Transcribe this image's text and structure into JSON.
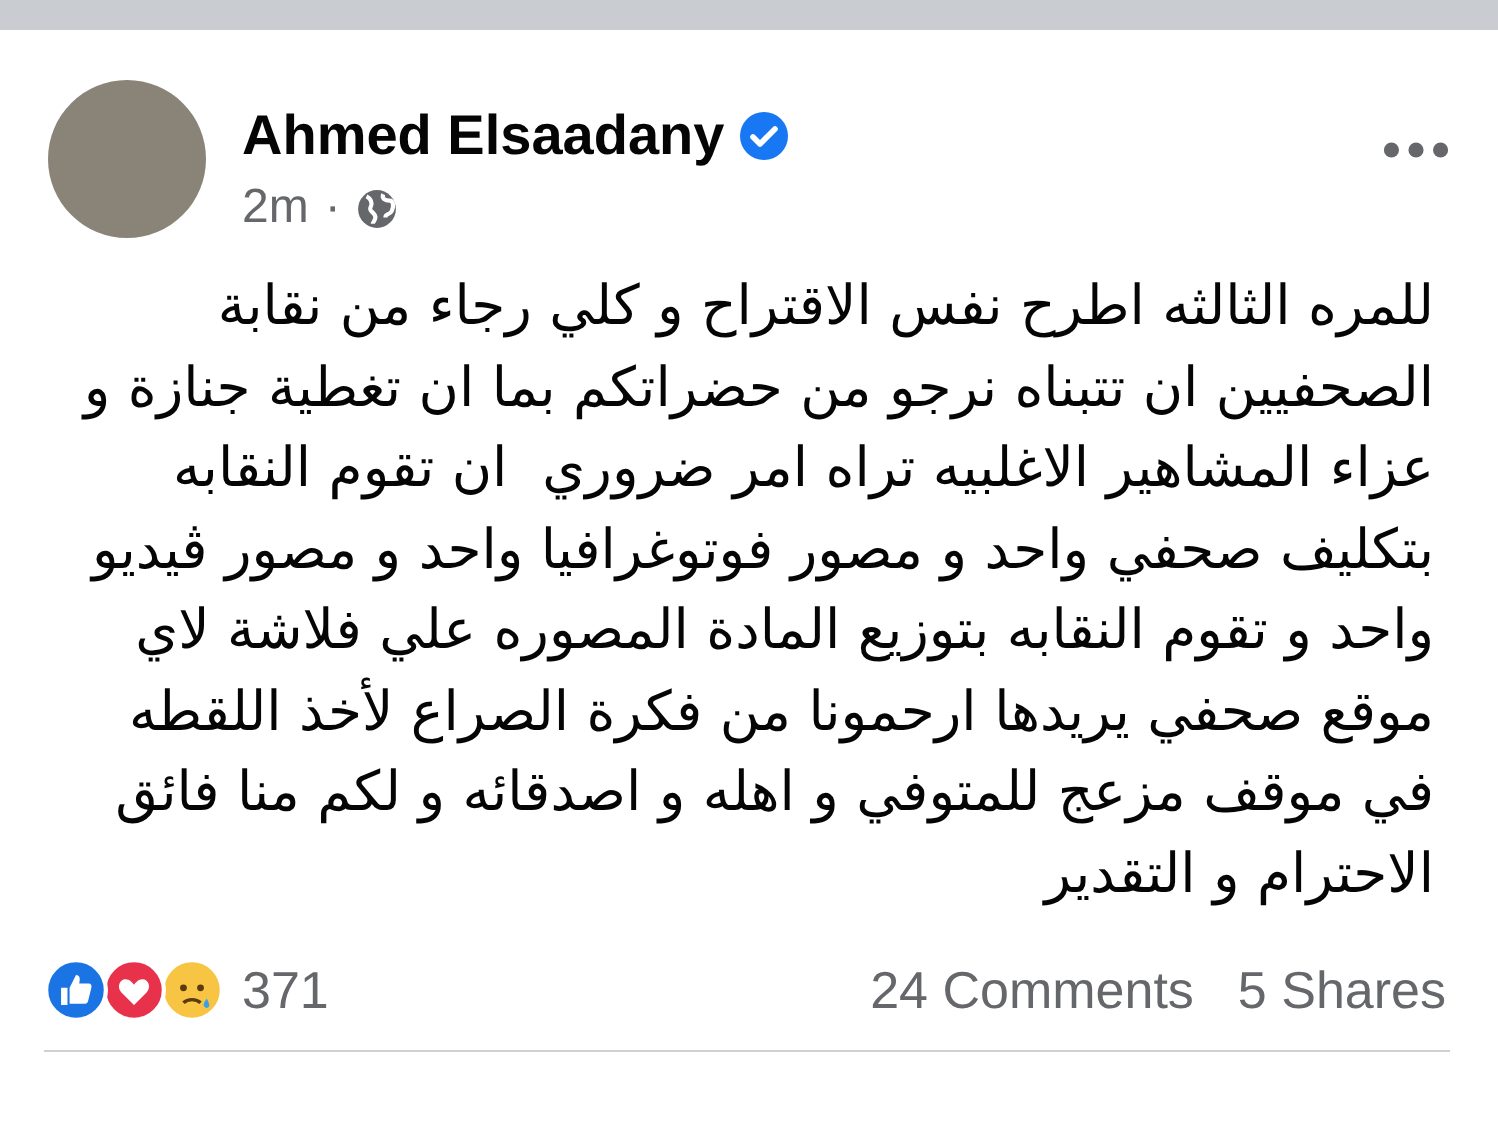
{
  "post": {
    "author": "Ahmed Elsaadany",
    "verified": true,
    "time": "2m",
    "separator": "·",
    "text": "للمره الثالثه اطرح نفس الاقتراح و كلي رجاء من نقابة\nالصحفيين ان تتبناه نرجو من حضراتكم بما ان تغطية جنازة و\nعزاء المشاهير الاغلبيه تراه امر ضروري  ان تقوم النقابه\nبتكليف صحفي واحد و مصور فوتوغرافيا واحد و مصور ڤيديو\nواحد و تقوم النقابه بتوزيع المادة المصوره علي فلاشة لاي\nموقع صحفي يريدها ارحمونا من فكرة الصراع لأخذ اللقطه\nفي موقف مزعج للمتوفي و اهله و اصدقائه و لكم منا فائق\nالاحترام و التقدير"
  },
  "reactions": {
    "icons": [
      {
        "kind": "like"
      },
      {
        "kind": "love"
      },
      {
        "kind": "sad"
      }
    ],
    "count": "371"
  },
  "comments": "24 Comments",
  "shares": "5 Shares"
}
